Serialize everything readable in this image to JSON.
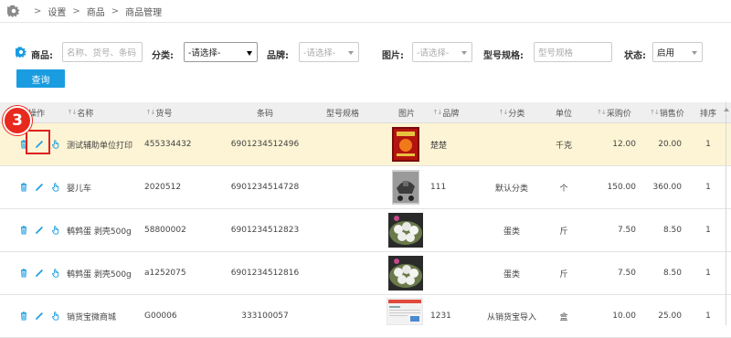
{
  "breadcrumb": {
    "items": [
      "设置",
      "商品",
      "商品管理"
    ],
    "separator": ">"
  },
  "filter": {
    "goods_label": "商品:",
    "goods_placeholder": "名称、货号、条码",
    "category_label": "分类:",
    "category_value": "-请选择-",
    "brand_label": "品牌:",
    "brand_value": "-请选择-",
    "picture_label": "图片:",
    "picture_value": "-请选择-",
    "model_label": "型号规格:",
    "model_placeholder": "型号规格",
    "status_label": "状态:",
    "status_value": "启用",
    "query_button": "查询"
  },
  "table": {
    "columns": {
      "action": "操作",
      "name": "名称",
      "code": "货号",
      "barcode": "条码",
      "model": "型号规格",
      "picture": "图片",
      "brand": "品牌",
      "category": "分类",
      "unit": "单位",
      "purchase_price": "采购价",
      "sale_price": "销售价",
      "sort": "排序"
    },
    "sortable_indicator": "↑↓",
    "rows": [
      {
        "name": "测试辅助单位打印",
        "code": "455334432",
        "barcode": "6901234512496",
        "model": "",
        "image": "red-poster-image",
        "brand": "楚楚",
        "category": "",
        "unit": "千克",
        "purchase_price": "12.00",
        "sale_price": "20.00",
        "sort": "1",
        "highlighted": true
      },
      {
        "name": "婴儿车",
        "code": "2020512",
        "barcode": "6901234514728",
        "model": "",
        "image": "stroller-photo",
        "brand": "111",
        "category": "默认分类",
        "unit": "个",
        "purchase_price": "150.00",
        "sale_price": "360.00",
        "sort": "1",
        "highlighted": false
      },
      {
        "name": "鹌鹑蛋 剥壳500g",
        "code": "58800002",
        "barcode": "6901234512823",
        "model": "",
        "image": "quail-eggs-photo",
        "brand": "",
        "category": "蛋类",
        "unit": "斤",
        "purchase_price": "7.50",
        "sale_price": "8.50",
        "sort": "1",
        "highlighted": false
      },
      {
        "name": "鹌鹑蛋 剥壳500g",
        "code": "a1252075",
        "barcode": "6901234512816",
        "model": "",
        "image": "quail-eggs-photo",
        "brand": "",
        "category": "蛋类",
        "unit": "斤",
        "purchase_price": "7.50",
        "sale_price": "8.50",
        "sort": "1",
        "highlighted": false
      },
      {
        "name": "销货宝微商城",
        "code": "G00006",
        "barcode": "333100057",
        "model": "",
        "image": "screenshot-thumbnail",
        "brand": "1231",
        "category": "从销货宝导入",
        "unit": "盒",
        "purchase_price": "10.00",
        "sale_price": "25.00",
        "sort": "1",
        "highlighted": false
      }
    ]
  },
  "annotation": {
    "step_number": "3"
  },
  "colors": {
    "accent": "#1a9ce0",
    "highlight_row": "#fcf4d4",
    "marker": "#e8291e"
  }
}
